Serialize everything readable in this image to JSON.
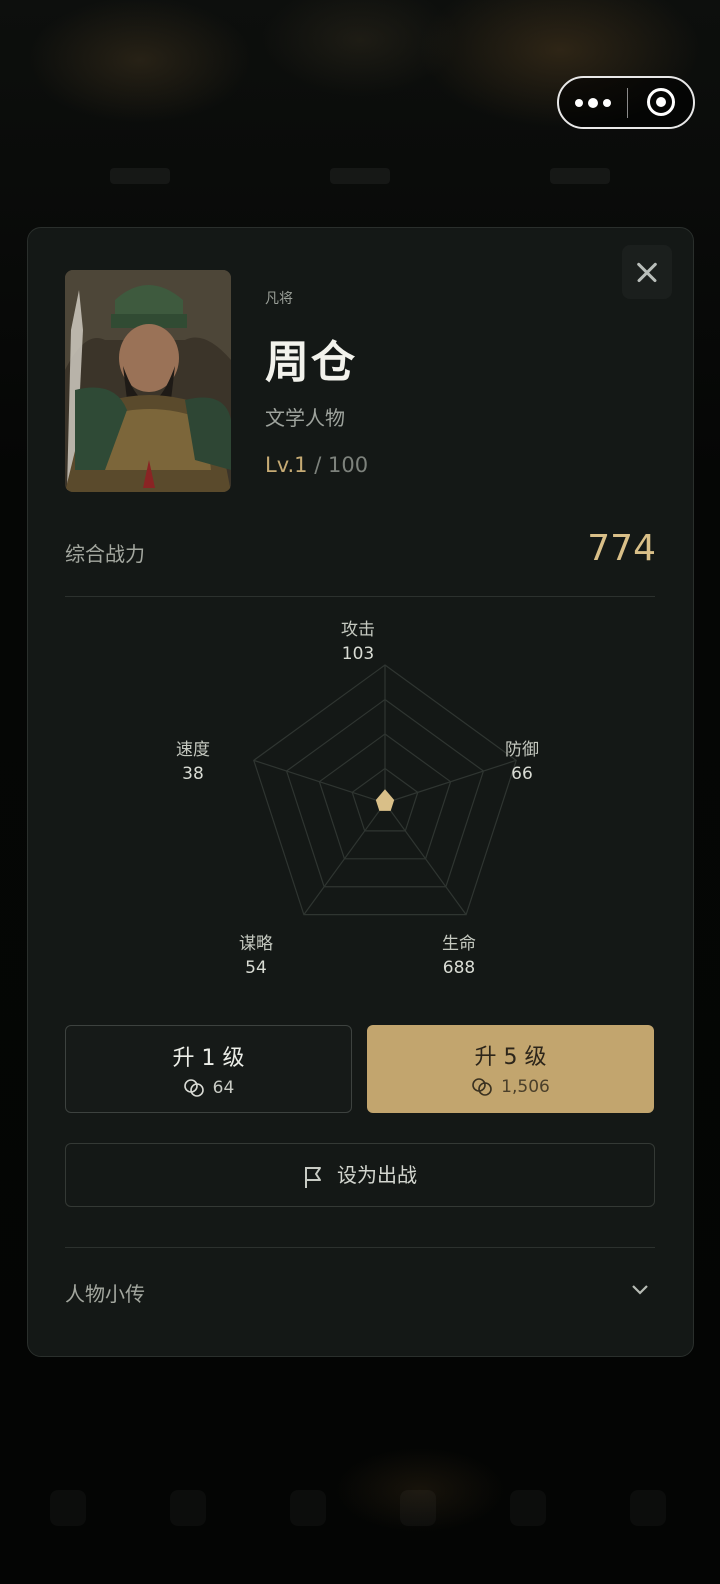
{
  "hero": {
    "rank": "凡将",
    "name": "周仓",
    "origin": "文学人物",
    "level_current": "Lv.1",
    "level_max": "/ 100"
  },
  "power": {
    "label": "综合战力",
    "value": "774"
  },
  "stats": {
    "attack": {
      "label": "攻击",
      "value": "103"
    },
    "defense": {
      "label": "防御",
      "value": "66"
    },
    "hp": {
      "label": "生命",
      "value": "688"
    },
    "strategy": {
      "label": "谋略",
      "value": "54"
    },
    "speed": {
      "label": "速度",
      "value": "38"
    }
  },
  "radar_fill_fractions": {
    "attack": 0.1,
    "defense": 0.07,
    "hp": 0.07,
    "strategy": 0.07,
    "speed": 0.07
  },
  "actions": {
    "upgrade1": {
      "label": "升 1 级",
      "cost": "64"
    },
    "upgrade5": {
      "label": "升 5 级",
      "cost": "1,506"
    },
    "deploy_label": "设为出战"
  },
  "bio": {
    "label": "人物小传"
  },
  "icons": {
    "close": "close-icon",
    "menu": "more-dots-icon",
    "capsule_close": "target-icon",
    "coin": "coin-icon",
    "flag": "flag-icon",
    "chevron": "chevron-down-icon"
  },
  "colors": {
    "accent": "#c2a56e",
    "card": "#141816",
    "power": "#d9bf88"
  }
}
